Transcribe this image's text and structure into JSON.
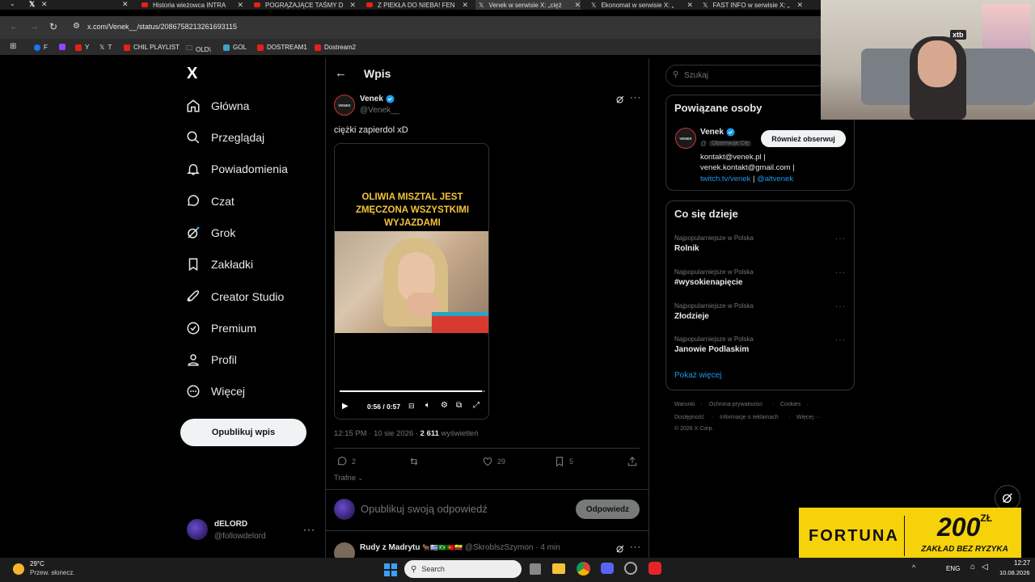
{
  "browser": {
    "tabs": [
      {
        "label": "",
        "active": false
      },
      {
        "label": "Historia wieżowca INTRA",
        "active": false
      },
      {
        "label": "POGRĄŻAJĄCE TAŚMY D",
        "active": false
      },
      {
        "label": "Z PIEKŁA DO NIEBA! FEN",
        "active": false
      },
      {
        "label": "Venek w serwisie X: „cięż",
        "active": true
      },
      {
        "label": "Ekonomat w serwisie X: „",
        "active": false
      },
      {
        "label": "FAST INFO w serwisie X: „",
        "active": false
      }
    ],
    "url": "x.com/Venek__/status/2086758213261693115",
    "bookmarks": [
      "F",
      "",
      "Y",
      "T",
      "CHIL PLAYLIST",
      "OLD\\",
      "GOL",
      "DOSTREAM1",
      "Dostream2"
    ]
  },
  "left_nav": {
    "logo": "X",
    "items": [
      {
        "label": "Główna",
        "icon": "home-icon"
      },
      {
        "label": "Przeglądaj",
        "icon": "search-icon"
      },
      {
        "label": "Powiadomienia",
        "icon": "bell-icon"
      },
      {
        "label": "Czat",
        "icon": "chat-icon"
      },
      {
        "label": "Grok",
        "icon": "grok-icon"
      },
      {
        "label": "Zakładki",
        "icon": "bookmark-icon"
      },
      {
        "label": "Creator Studio",
        "icon": "rocket-icon"
      },
      {
        "label": "Premium",
        "icon": "premium-icon"
      },
      {
        "label": "Profil",
        "icon": "person-icon"
      },
      {
        "label": "Więcej",
        "icon": "more-circle-icon"
      }
    ],
    "post_button": "Opublikuj wpis",
    "account": {
      "name": "dELORD",
      "handle": "@followdelord"
    }
  },
  "post": {
    "header_title": "Wpis",
    "author_name": "Venek",
    "author_handle": "@Venek__",
    "avatar_text": "VENEK",
    "text": "ciężki zapierdol xD",
    "video": {
      "caption_lines": [
        "OLIWIA MISZTAL JEST",
        "ZMĘCZONA WSZYSTKIMI",
        "WYJAZDAMI"
      ],
      "time": "0:56 / 0:57",
      "progress": 0.98
    },
    "meta_time": "12:15 PM · 10 sie 2026 · ",
    "views_count": "2 611",
    "views_label": " wyświetleń",
    "actions": {
      "replies": "2",
      "reposts": "",
      "likes": "29",
      "bookmarks": "5"
    },
    "sort_label": "Trafne",
    "reply_placeholder": "Opublikuj swoją odpowiedź",
    "reply_button": "Odpowiedz",
    "next_reply": {
      "name": "Rudy z Madrytu",
      "flags": "🐂🇺🇾🇧🇷🇵🇹🇪🇨",
      "handle": "@SkroblszSzymon",
      "time": "· 4 min"
    }
  },
  "right": {
    "search_placeholder": "Szukaj",
    "related": {
      "title": "Powiązane osoby",
      "name": "Venek",
      "handle": "@",
      "follows_you": "Obserwuje Cię",
      "follow_button": "Również obserwuj",
      "bio_line1": "kontakt@venek.pl |",
      "bio_line2": "venek.kontakt@gmail.com |",
      "bio_link1": "twitch.tv/venek",
      "bio_sep": " | ",
      "bio_link2": "@altvenek"
    },
    "trends": {
      "title": "Co się dzieje",
      "items": [
        {
          "category": "Najpopularniejsze w Polska",
          "name": "Rolnik"
        },
        {
          "category": "Najpopularniejsze w Polska",
          "name": "#wysokienapięcie"
        },
        {
          "category": "Najpopularniejsze w Polska",
          "name": "Złodzieje"
        },
        {
          "category": "Najpopularniejsze w Polska",
          "name": "Janowie Podlaskim"
        }
      ],
      "show_more": "Pokaż więcej"
    },
    "footer": {
      "line1": [
        "Warunki",
        "Ochrona prywatności",
        "Cookies"
      ],
      "line2": [
        "Dostępność",
        "Informacje o reklamach",
        "Więcej ···"
      ],
      "copyright": "© 2026 X Corp."
    }
  },
  "overlay": {
    "webcam_badge": "xtb",
    "ad_brand": "FORTUNA",
    "ad_amount": "200",
    "ad_currency": "ZŁ",
    "ad_tagline": "ZAKŁAD BEZ RYZYKA"
  },
  "taskbar": {
    "weather_temp": "29°C",
    "weather_desc": "Przew. słonecz.",
    "search_label": "Search",
    "lang": "ENG",
    "time": "12:27",
    "date": "10.08.2026"
  },
  "colors": {
    "accent": "#1d9bf0",
    "verified": "#1d9bf0",
    "background": "#000000",
    "border": "#2f3336",
    "muted": "#71767b",
    "ad_yellow": "#f6d20a",
    "caption_yellow": "#f5c33b"
  }
}
